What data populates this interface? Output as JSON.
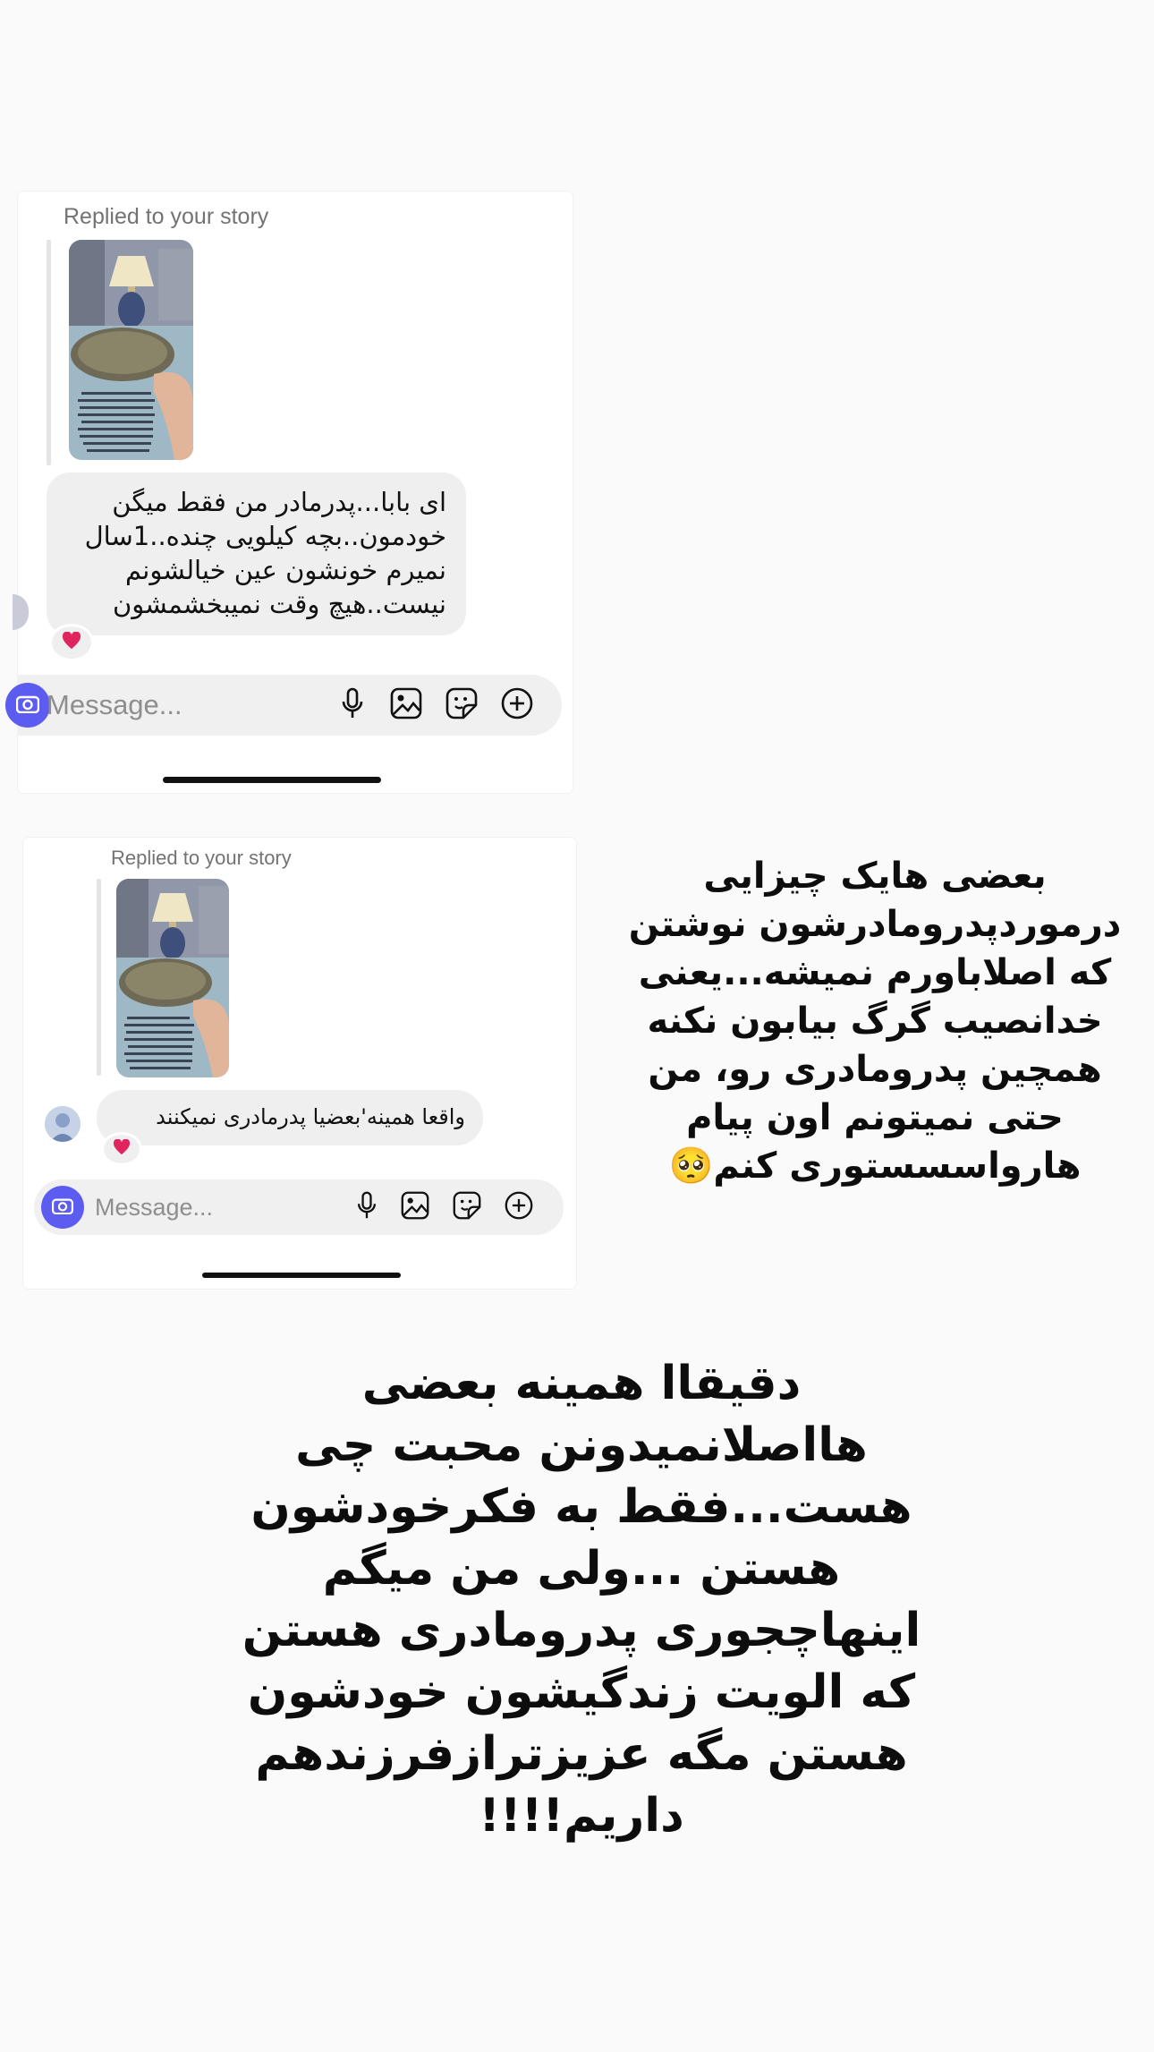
{
  "screenshots": [
    {
      "replied_label": "Replied to your story",
      "message": "ای بابا...پدرمادر من فقط میگن خودمون..بچه کیلویی چنده..1سال نمیرم خونشون عین خیالشونم نیست..هیچ وقت نمیبخشمشون",
      "reaction": "❤️",
      "composer_placeholder": "Message..."
    },
    {
      "replied_label": "Replied to your story",
      "message": "واقعا همینه'بعضیا پدرمادری نمیکنند",
      "reaction": "❤️",
      "composer_placeholder": "Message..."
    }
  ],
  "captions": {
    "first": "بعضی هایک چیزایی درموردپدرومادرشون نوشتن که اصلاباورم نمیشه...یعنی خدانصیب گرگ بیابون نکنه همچین پدرومادری رو، من حتی نمیتونم اون پیام هارواسسستوری کنم🥺",
    "second": "دقیقاا همینه بعضی هااصلانمیدونن محبت چی هست...فقط به فکرخودشون هستن ...ولی من میگم اینهاچجوری پدرومادری هستن که الویت زندگیشون خودشون هستن مگه عزیزترازفرزندهم داریم!!!!"
  },
  "icons": [
    "camera-icon",
    "microphone-icon",
    "gallery-icon",
    "sticker-icon",
    "add-icon",
    "heart-reaction-icon"
  ],
  "colors": {
    "accent": "#5c5cf0",
    "bubble": "#efefef",
    "heart": "#e0245e"
  }
}
